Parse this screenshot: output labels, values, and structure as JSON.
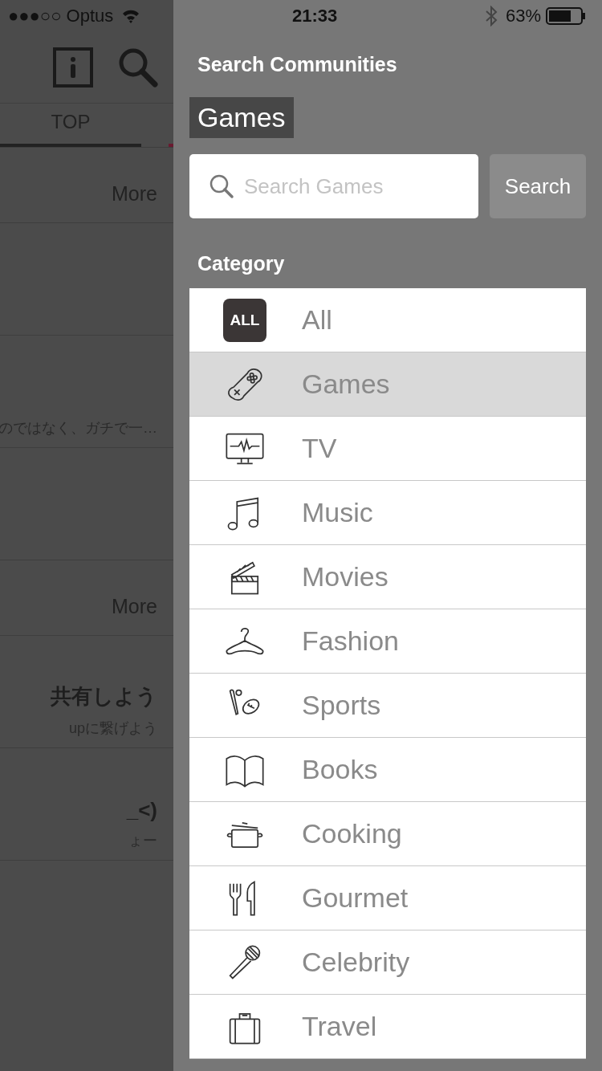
{
  "status_bar": {
    "carrier": "●●●○○ Optus",
    "time": "21:33",
    "battery": "63%"
  },
  "background_screen": {
    "tabs": [
      {
        "label": "TOP",
        "selected": true
      }
    ],
    "rows": [
      {
        "kind": "header",
        "link": "More"
      },
      {
        "kind": "empty"
      },
      {
        "kind": "item",
        "subtitle": "のではなく、ガチで一…"
      },
      {
        "kind": "empty"
      },
      {
        "kind": "header",
        "link": "More"
      },
      {
        "kind": "item",
        "title": "共有しよう",
        "subtitle": "upに繋げよう"
      },
      {
        "kind": "item",
        "title": "_<)",
        "subtitle": "ょー"
      },
      {
        "kind": "empty"
      }
    ]
  },
  "drawer": {
    "title": "Search Communities",
    "current": "Games",
    "search": {
      "placeholder": "Search Games",
      "button": "Search"
    },
    "section": "Category",
    "categories": [
      {
        "kind": "badge",
        "badge": "ALL",
        "label": "All",
        "selected": false
      },
      {
        "kind": "icon",
        "label": "Games",
        "selected": true
      },
      {
        "kind": "icon",
        "label": "TV",
        "selected": false
      },
      {
        "kind": "icon",
        "label": "Music",
        "selected": false
      },
      {
        "kind": "icon",
        "label": "Movies",
        "selected": false
      },
      {
        "kind": "icon",
        "label": "Fashion",
        "selected": false
      },
      {
        "kind": "icon",
        "label": "Sports",
        "selected": false
      },
      {
        "kind": "icon",
        "label": "Books",
        "selected": false
      },
      {
        "kind": "icon",
        "label": "Cooking",
        "selected": false
      },
      {
        "kind": "icon",
        "label": "Gourmet",
        "selected": false
      },
      {
        "kind": "icon",
        "label": "Celebrity",
        "selected": false
      },
      {
        "kind": "icon",
        "label": "Travel",
        "selected": false
      }
    ]
  }
}
